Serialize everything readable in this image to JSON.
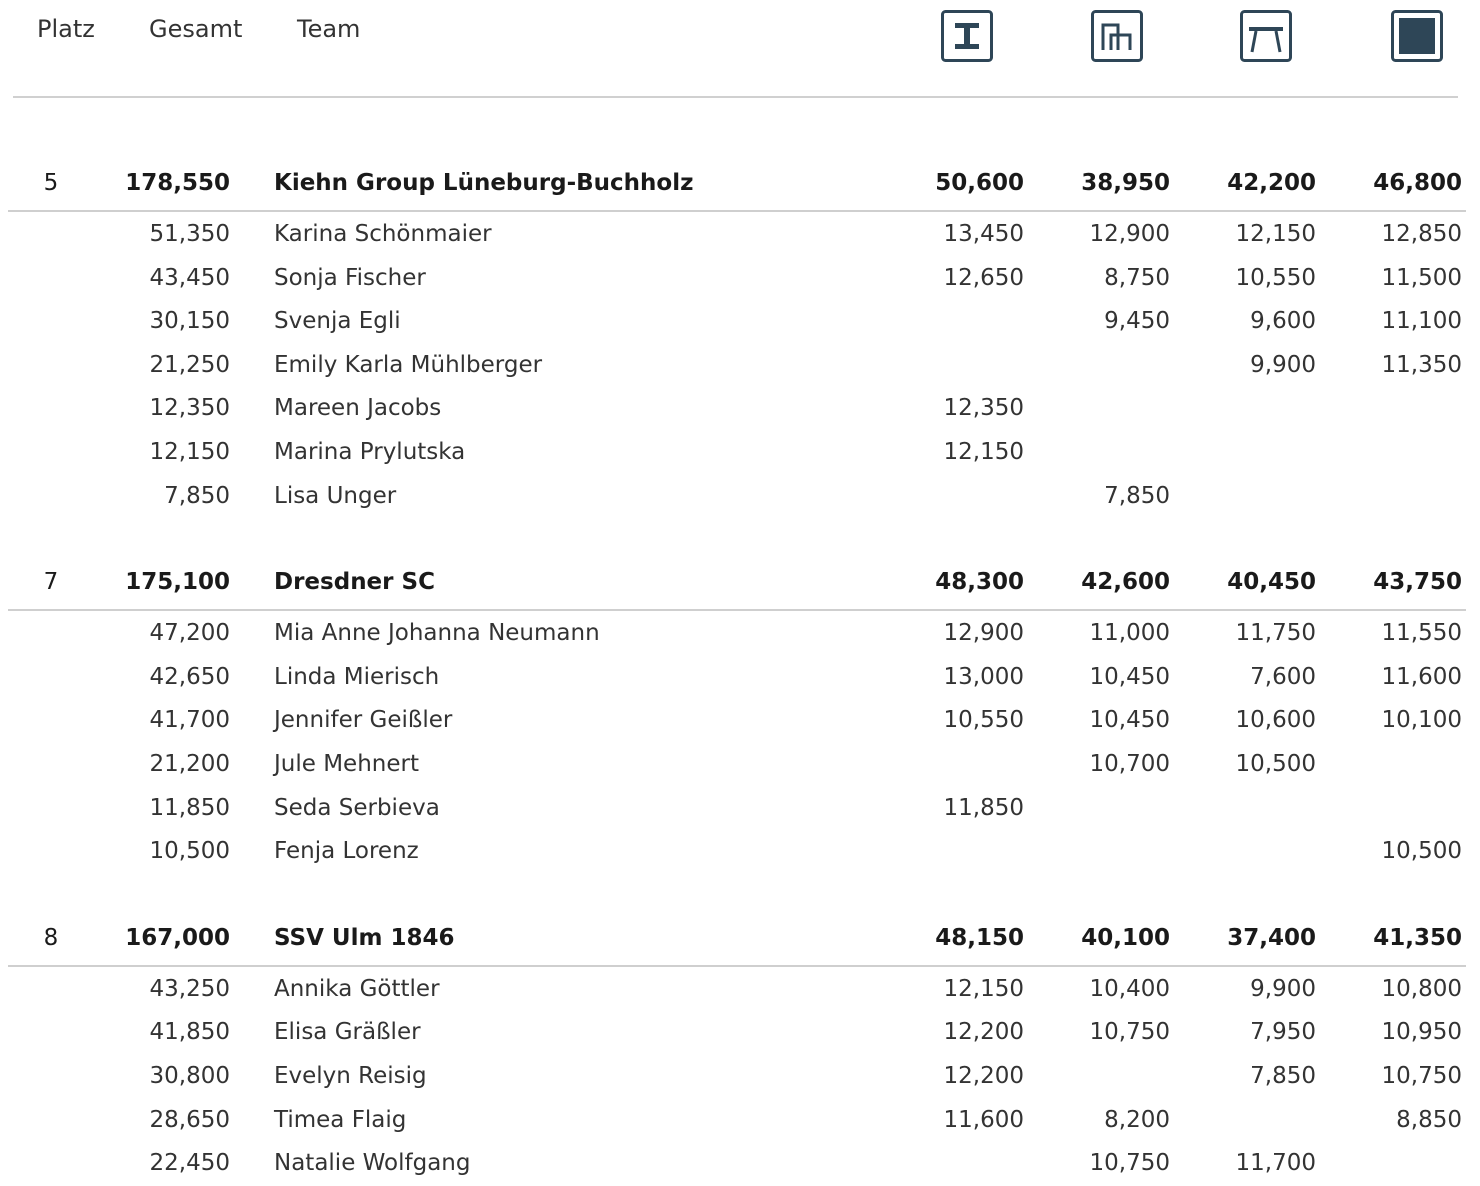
{
  "header": {
    "place": "Platz",
    "total": "Gesamt",
    "team": "Team",
    "apparatus_icons": [
      "vault-icon",
      "uneven-bars-icon",
      "balance-beam-icon",
      "floor-icon"
    ],
    "icon_color": "#2e4657"
  },
  "teams": [
    {
      "place": "5",
      "total": "178,550",
      "name": "Kiehn Group Lüneburg-Buchholz",
      "scores": [
        "50,600",
        "38,950",
        "42,200",
        "46,800"
      ],
      "members": [
        {
          "total": "51,350",
          "name": "Karina Schönmaier",
          "scores": [
            "13,450",
            "12,900",
            "12,150",
            "12,850"
          ]
        },
        {
          "total": "43,450",
          "name": "Sonja Fischer",
          "scores": [
            "12,650",
            "8,750",
            "10,550",
            "11,500"
          ]
        },
        {
          "total": "30,150",
          "name": "Svenja Egli",
          "scores": [
            "",
            "9,450",
            "9,600",
            "11,100"
          ]
        },
        {
          "total": "21,250",
          "name": "Emily Karla Mühlberger",
          "scores": [
            "",
            "",
            "9,900",
            "11,350"
          ]
        },
        {
          "total": "12,350",
          "name": "Mareen Jacobs",
          "scores": [
            "12,350",
            "",
            "",
            ""
          ]
        },
        {
          "total": "12,150",
          "name": "Marina Prylutska",
          "scores": [
            "12,150",
            "",
            "",
            ""
          ]
        },
        {
          "total": "7,850",
          "name": "Lisa Unger",
          "scores": [
            "",
            "7,850",
            "",
            ""
          ]
        }
      ]
    },
    {
      "place": "7",
      "total": "175,100",
      "name": "Dresdner SC",
      "scores": [
        "48,300",
        "42,600",
        "40,450",
        "43,750"
      ],
      "members": [
        {
          "total": "47,200",
          "name": "Mia Anne Johanna Neumann",
          "scores": [
            "12,900",
            "11,000",
            "11,750",
            "11,550"
          ]
        },
        {
          "total": "42,650",
          "name": "Linda Mierisch",
          "scores": [
            "13,000",
            "10,450",
            "7,600",
            "11,600"
          ]
        },
        {
          "total": "41,700",
          "name": "Jennifer Geißler",
          "scores": [
            "10,550",
            "10,450",
            "10,600",
            "10,100"
          ]
        },
        {
          "total": "21,200",
          "name": "Jule Mehnert",
          "scores": [
            "",
            "10,700",
            "10,500",
            ""
          ]
        },
        {
          "total": "11,850",
          "name": "Seda Serbieva",
          "scores": [
            "11,850",
            "",
            "",
            ""
          ]
        },
        {
          "total": "10,500",
          "name": "Fenja Lorenz",
          "scores": [
            "",
            "",
            "",
            "10,500"
          ]
        }
      ]
    },
    {
      "place": "8",
      "total": "167,000",
      "name": "SSV Ulm 1846",
      "scores": [
        "48,150",
        "40,100",
        "37,400",
        "41,350"
      ],
      "members": [
        {
          "total": "43,250",
          "name": "Annika Göttler",
          "scores": [
            "12,150",
            "10,400",
            "9,900",
            "10,800"
          ]
        },
        {
          "total": "41,850",
          "name": "Elisa Gräßler",
          "scores": [
            "12,200",
            "10,750",
            "7,950",
            "10,950"
          ]
        },
        {
          "total": "30,800",
          "name": "Evelyn Reisig",
          "scores": [
            "12,200",
            "",
            "7,850",
            "10,750"
          ]
        },
        {
          "total": "28,650",
          "name": "Timea Flaig",
          "scores": [
            "11,600",
            "8,200",
            "",
            "8,850"
          ]
        },
        {
          "total": "22,450",
          "name": "Natalie Wolfgang",
          "scores": [
            "",
            "10,750",
            "11,700",
            ""
          ]
        }
      ]
    }
  ]
}
